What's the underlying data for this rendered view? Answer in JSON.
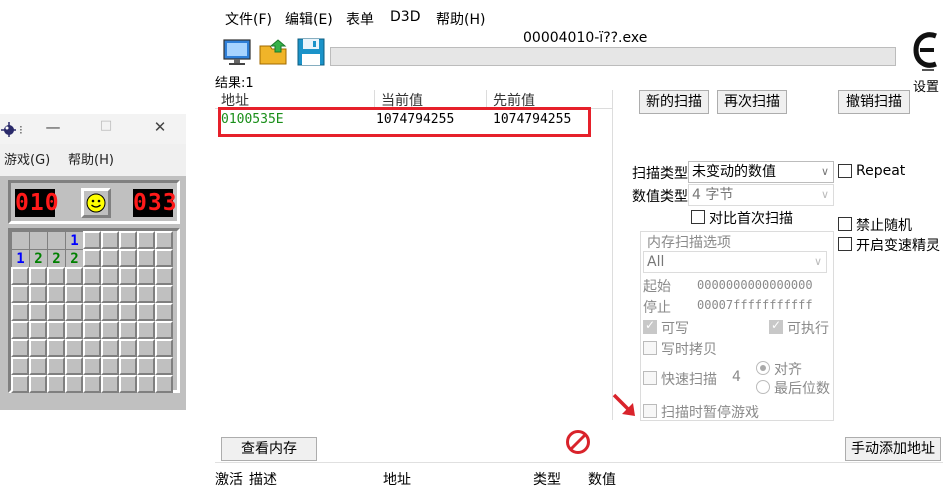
{
  "minesweeper": {
    "menu": [
      "游戏(G)",
      "帮助(H)"
    ],
    "titlebar_sep": "⁝",
    "mine_counter": "010",
    "timer": "033",
    "open_cells": [
      {
        "row": 0,
        "col": 0,
        "value": ""
      },
      {
        "row": 0,
        "col": 1,
        "value": ""
      },
      {
        "row": 0,
        "col": 2,
        "value": ""
      },
      {
        "row": 0,
        "col": 3,
        "value": "1"
      },
      {
        "row": 1,
        "col": 0,
        "value": "1"
      },
      {
        "row": 1,
        "col": 1,
        "value": "2"
      },
      {
        "row": 1,
        "col": 2,
        "value": "2"
      },
      {
        "row": 1,
        "col": 3,
        "value": "2"
      }
    ]
  },
  "ce": {
    "menu": [
      "文件(F)",
      "编辑(E)",
      "表单",
      "D3D",
      "帮助(H)"
    ],
    "process_title": "00004010-ï??.exe",
    "settings_label": "设置",
    "results_label": "结果:1",
    "columns": [
      "地址",
      "当前值",
      "先前值"
    ],
    "rows": [
      {
        "address": "0100535E",
        "current": "1074794255",
        "previous": "1074794255"
      }
    ],
    "buttons": {
      "new_scan": "新的扫描",
      "next_scan": "再次扫描",
      "undo_scan": "撤销扫描",
      "view_memory": "查看内存",
      "add_address": "手动添加地址"
    },
    "scan_type_label": "扫描类型",
    "scan_type_value": "未变动的数值",
    "value_type_label": "数值类型",
    "value_type_value": "4 字节",
    "compare_first": "对比首次扫描",
    "repeat": "Repeat",
    "no_random": "禁止随机",
    "speedhack": "开启变速精灵",
    "mem_options": {
      "title": "内存扫描选项",
      "region": "All",
      "start_label": "起始",
      "start_value": "0000000000000000",
      "stop_label": "停止",
      "stop_value": "00007fffffffffff",
      "writable": "可写",
      "executable": "可执行",
      "copy_on_write": "写时拷贝",
      "fast_scan": "快速扫描",
      "fast_scan_value": "4",
      "align": "对齐",
      "last_digits": "最后位数",
      "pause_game": "扫描时暂停游戏"
    },
    "address_list_columns": [
      "激活",
      "描述",
      "地址",
      "类型",
      "数值"
    ]
  }
}
